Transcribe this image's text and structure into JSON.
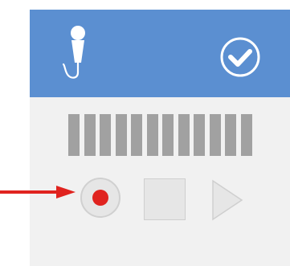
{
  "header": {
    "icon": "microphone-icon",
    "confirm_icon": "checkmark-circle-icon",
    "color": "#5b8fd1"
  },
  "level_meter": {
    "bar_count": 12,
    "color": "#a1a1a1"
  },
  "controls": {
    "record": {
      "icon": "record-icon",
      "color": "#e0231f"
    },
    "stop": {
      "icon": "stop-icon"
    },
    "play": {
      "icon": "play-icon"
    }
  },
  "annotation": {
    "icon": "red-arrow-icon",
    "color": "#e0231f",
    "points_to": "record-button"
  }
}
